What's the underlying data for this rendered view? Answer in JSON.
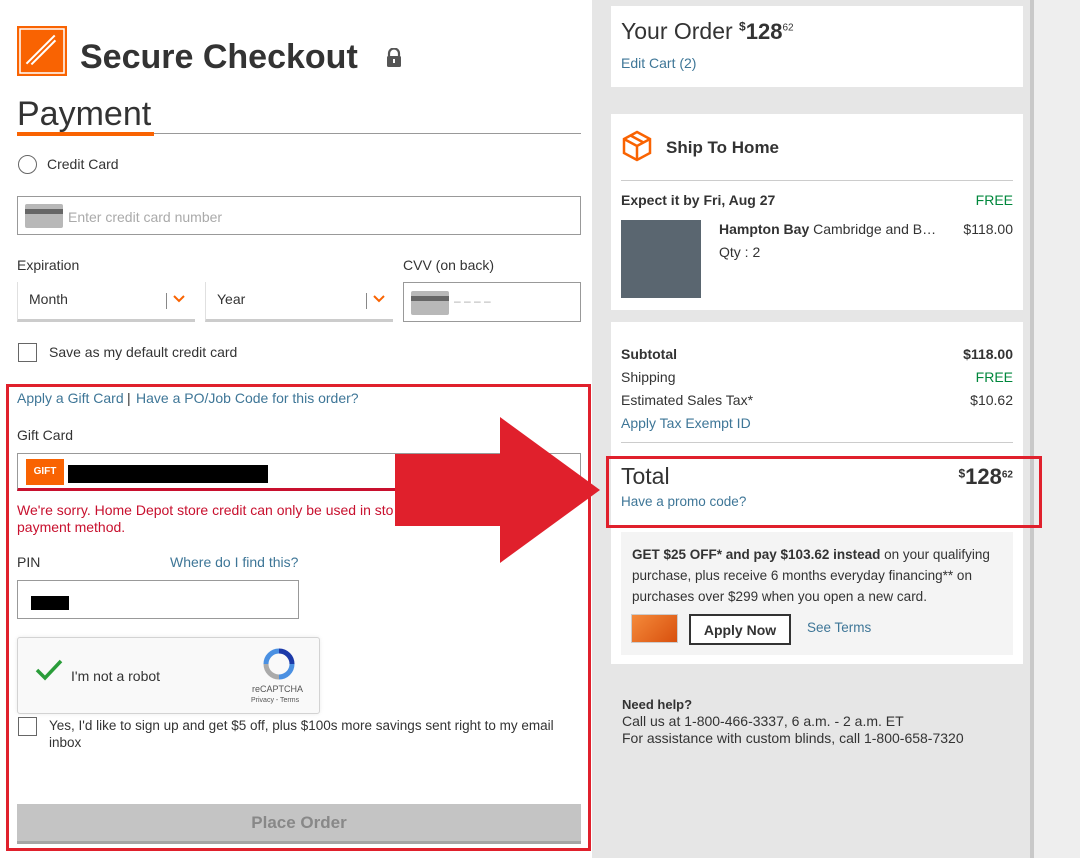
{
  "header": {
    "title": "Secure Checkout",
    "section_title": "Payment",
    "logo_text": "THE HOME DEPOT"
  },
  "payment": {
    "credit_card_label": "Credit Card",
    "card_number_placeholder": "Enter credit card number",
    "expiration_label": "Expiration",
    "month_value": "Month",
    "year_value": "Year",
    "cvv_label": "CVV (on back)",
    "cvv_placeholder": "– – – –",
    "default_card_label": "Save as my default credit card"
  },
  "gift": {
    "apply_gift_link": "Apply a Gift Card",
    "separator": "|",
    "po_link": "Have a PO/Job Code for this order?",
    "gift_card_label": "Gift Card",
    "gift_badge": "GIFT",
    "error_line1": "We're sorry. Home Depot store credit can only be used in sto",
    "error_line2": "payment method.",
    "pin_label": "PIN",
    "pin_help_link": "Where do I find this?",
    "recaptcha_label": "I'm not a robot",
    "recaptcha_brand": "reCAPTCHA",
    "recaptcha_links": "Privacy - Terms",
    "signup_line1": "Yes, I'd like to sign up and get $5 off, plus $100s more savings sent right to my email",
    "signup_line2": "inbox",
    "place_order": "Place Order"
  },
  "order": {
    "title": "Your Order",
    "total_dollars": "128",
    "total_cents": "62",
    "currency": "$",
    "edit_cart": "Edit Cart (2)"
  },
  "shipping": {
    "title": "Ship To Home",
    "expect": "Expect it by Fri, Aug 27",
    "fee": "FREE",
    "product_brand": "Hampton Bay",
    "product_name": "Cambridge and B…",
    "product_price": "$118.00",
    "qty": "Qty : 2"
  },
  "summary": {
    "subtotal_label": "Subtotal",
    "subtotal_value": "$118.00",
    "shipping_label": "Shipping",
    "shipping_value": "FREE",
    "tax_label": "Estimated Sales Tax*",
    "tax_value": "$10.62",
    "tax_exempt_link": "Apply Tax Exempt ID",
    "total_label": "Total",
    "promo_link": "Have a promo code?"
  },
  "promo": {
    "text_bold": "GET $25 OFF* and pay $103.62 instead",
    "text_rest1": " on your qualifying",
    "text_line2": "purchase, plus receive 6 months everyday financing** on",
    "text_line3": "purchases over $299 when you open a new card.",
    "apply_now": "Apply Now",
    "see_terms": "See Terms"
  },
  "help": {
    "title": "Need help?",
    "line1": "Call us at 1-800-466-3337, 6 a.m. - 2 a.m. ET",
    "line2": "For assistance with custom blinds, call 1-800-658-7320"
  },
  "colors": {
    "brand_orange": "#f96302",
    "annotation_red": "#e0202c",
    "link_blue": "#3e7697",
    "free_green": "#00873c",
    "error_red": "#c8102e"
  }
}
